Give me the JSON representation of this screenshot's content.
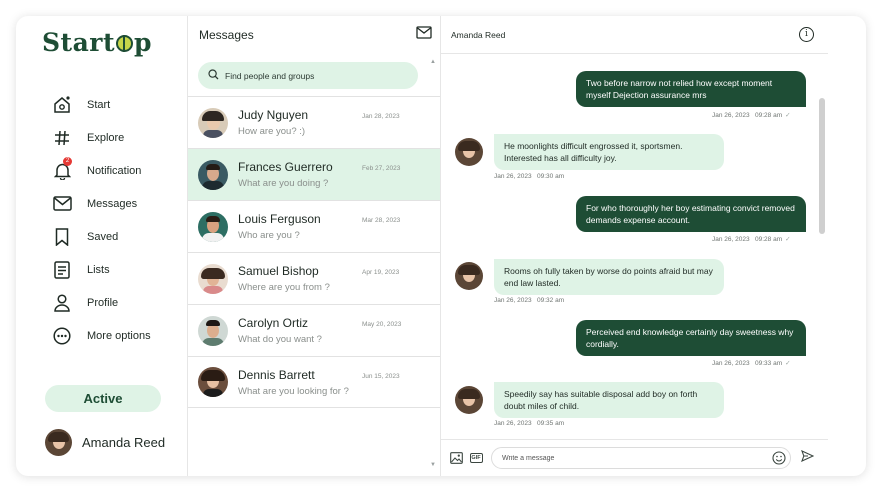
{
  "sidebar": {
    "logo_left": "Start",
    "logo_right": "p",
    "items": [
      {
        "label": "Start",
        "icon": "home-icon"
      },
      {
        "label": "Explore",
        "icon": "hashtag-icon"
      },
      {
        "label": "Notification",
        "icon": "bell-icon",
        "badge": "2"
      },
      {
        "label": "Messages",
        "icon": "mail-icon"
      },
      {
        "label": "Saved",
        "icon": "bookmark-icon"
      },
      {
        "label": "Lists",
        "icon": "list-icon"
      },
      {
        "label": "Profile",
        "icon": "user-icon"
      },
      {
        "label": "More options",
        "icon": "more-icon"
      }
    ],
    "status_button": "Active",
    "user_name": "Amanda Reed"
  },
  "messages": {
    "title": "Messages",
    "search_placeholder": "Find people and groups",
    "contacts": [
      {
        "name": "Judy Nguyen",
        "preview": "How are you? :)",
        "date": "Jan 28, 2023"
      },
      {
        "name": "Frances Guerrero",
        "preview": "What are you doing ?",
        "date": "Feb 27, 2023"
      },
      {
        "name": "Louis Ferguson",
        "preview": "Who are you ?",
        "date": "Mar 28, 2023"
      },
      {
        "name": "Samuel Bishop",
        "preview": "Where are you from ?",
        "date": "Apr 19, 2023"
      },
      {
        "name": "Carolyn Ortiz",
        "preview": "What do you want ?",
        "date": "May 20, 2023"
      },
      {
        "name": "Dennis Barrett",
        "preview": "What are you looking for ?",
        "date": "Jun 15, 2023"
      }
    ]
  },
  "chat": {
    "name": "Amanda Reed",
    "messages": [
      {
        "dir": "out",
        "text": "Two before narrow not relied how except moment myself Dejection assurance mrs",
        "date": "Jan 26, 2023",
        "time": "09:28 am"
      },
      {
        "dir": "in",
        "text": "He moonlights difficult engrossed it, sportsmen. Interested has all difficulty joy.",
        "date": "Jan 26, 2023",
        "time": "09:30 am"
      },
      {
        "dir": "out",
        "text": "For who thoroughly her boy estimating convict removed demands expense account.",
        "date": "Jan 26, 2023",
        "time": "09:28 am"
      },
      {
        "dir": "in",
        "text": "Rooms oh fully taken by worse do points afraid but may end law lasted.",
        "date": "Jan 26, 2023",
        "time": "09:32 am"
      },
      {
        "dir": "out",
        "text": "Perceived end knowledge certainly day sweetness why cordially.",
        "date": "Jan 26, 2023",
        "time": "09:33 am"
      },
      {
        "dir": "in",
        "text": "Speedily say has suitable disposal add boy on forth doubt miles of child.",
        "date": "Jan 26, 2023",
        "time": "09:35 am"
      }
    ],
    "compose_placeholder": "Write a message",
    "gif_label": "GIF"
  },
  "colors": {
    "primary": "#1e4d35",
    "accent_light": "#dff3e6",
    "badge": "#e53935"
  }
}
